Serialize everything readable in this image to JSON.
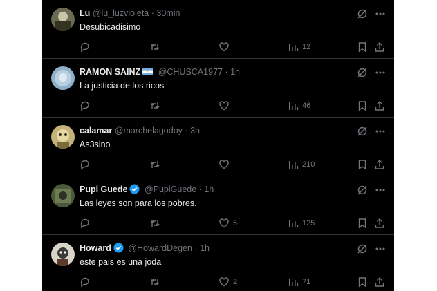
{
  "tweets": [
    {
      "name": "Lu",
      "handle": "@lu_luzvioleta",
      "dot": "·",
      "time": "30min",
      "text": "Desubicadisimo",
      "likes": "",
      "views": "12",
      "badge": "none"
    },
    {
      "name": "RAMON SAINZ",
      "handle": "@CHUSCA1977",
      "dot": "·",
      "time": "1h",
      "text": "La justicia de los ricos",
      "likes": "",
      "views": "46",
      "badge": "flag-argentina"
    },
    {
      "name": "calamar",
      "handle": "@marchelagodoy",
      "dot": "·",
      "time": "3h",
      "text": "As3sino",
      "likes": "",
      "views": "210",
      "badge": "none"
    },
    {
      "name": "Pupi Guede",
      "handle": "@PupiGuede",
      "dot": "·",
      "time": "1h",
      "text": "Las leyes son para los pobres.",
      "likes": "5",
      "views": "125",
      "badge": "verified"
    },
    {
      "name": "Howard",
      "handle": "@HowardDegen",
      "dot": "·",
      "time": "1h",
      "text": "este pais es una joda",
      "likes": "2",
      "views": "71",
      "badge": "verified"
    }
  ],
  "colors": {
    "background": "#000000",
    "text": "#e7e9ea",
    "muted": "#71767b",
    "verified": "#1d9bf0",
    "separator": "#2f3336"
  }
}
